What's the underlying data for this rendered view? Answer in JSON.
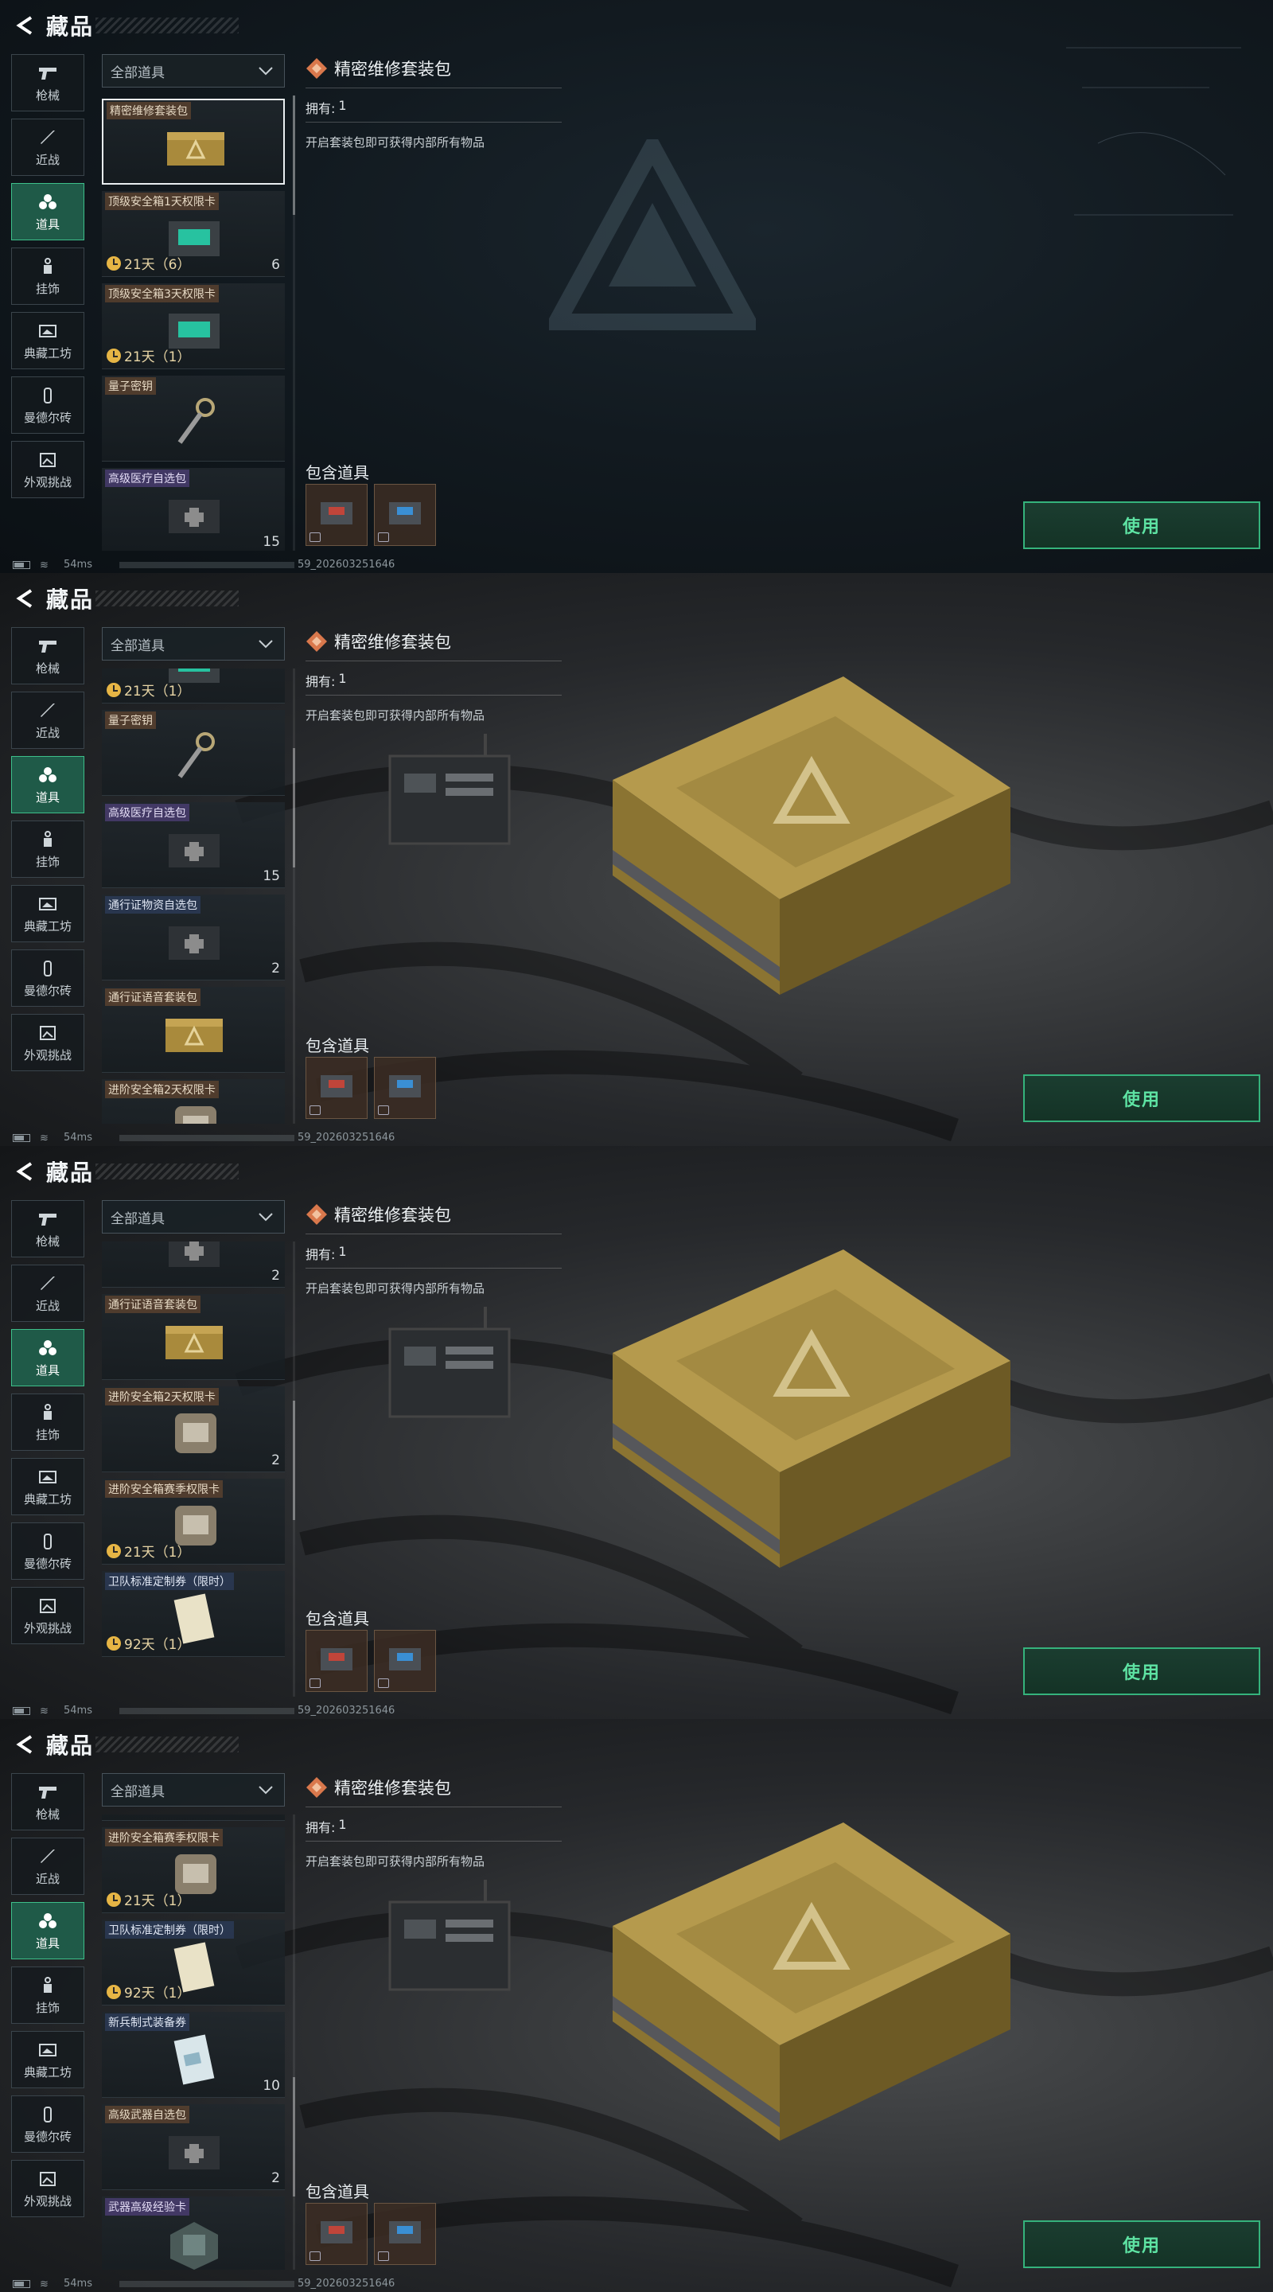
{
  "header": {
    "title": "藏品"
  },
  "categories": [
    {
      "label": "枪械",
      "icon": "gun-icon"
    },
    {
      "label": "近战",
      "icon": "knife-icon"
    },
    {
      "label": "道具",
      "icon": "items-icon"
    },
    {
      "label": "挂饰",
      "icon": "charm-icon"
    },
    {
      "label": "典藏工坊",
      "icon": "workshop-icon"
    },
    {
      "label": "曼德尔砖",
      "icon": "brick-icon"
    },
    {
      "label": "外观挑战",
      "icon": "challenge-icon"
    }
  ],
  "active_category": "道具",
  "filter": {
    "label": "全部道具"
  },
  "items": {
    "i1": {
      "name": "精密维修套装包"
    },
    "i2": {
      "name": "顶级安全箱1天权限卡",
      "timer": "21天（6）",
      "count": "6"
    },
    "i3": {
      "name": "顶级安全箱3天权限卡",
      "timer": "21天（1）"
    },
    "i4": {
      "name": "量子密钥"
    },
    "i5": {
      "name": "高级医疗自选包",
      "count": "15"
    },
    "i6": {
      "name": "通行证物资自选包",
      "count": "2"
    },
    "i7": {
      "name": "通行证语音套装包"
    },
    "i8": {
      "name": "进阶安全箱2天权限卡",
      "count": "2"
    },
    "i9": {
      "name": "进阶安全箱赛季权限卡",
      "timer": "21天（1）"
    },
    "i10": {
      "name": "卫队标准定制券（限时）",
      "timer": "92天（1）"
    },
    "i11": {
      "name": "新兵制式装备券",
      "count": "10"
    },
    "i12": {
      "name": "高级武器自选包",
      "count": "2"
    },
    "i13": {
      "name": "武器高级经验卡"
    },
    "partial_count_2": "2"
  },
  "detail": {
    "title": "精密维修套装包",
    "own_label": "拥有:",
    "own_value": "1",
    "description": "开启套装包即可获得内部所有物品",
    "contains_label": "包含道具",
    "use_label": "使用"
  },
  "status": {
    "ping": "54ms",
    "build": "59_202603251646"
  },
  "colors": {
    "accent": "#35b37c",
    "active_tab": "#1f5a48",
    "use_text": "#5ee3a3",
    "timer": "#e6b545"
  }
}
